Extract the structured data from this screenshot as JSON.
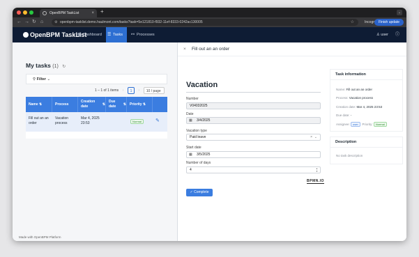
{
  "browser": {
    "tab_title": "OpenBPM TaskList",
    "url": "openbpm-tasklist.demo.haulmont.com/tasks?task=5e121810-f932-11ef-8333-0242ac130005",
    "incognito_label": "Incognito",
    "finish_update_label": "Finish update"
  },
  "app": {
    "logo": "OpenBPM TaskList",
    "nav": [
      "Dashboard",
      "Tasks",
      "Processes"
    ],
    "user": "user"
  },
  "tasks": {
    "title": "My tasks",
    "count": "(1)",
    "filter_label": "Filter",
    "pager_text": "1 – 1 of 1 items",
    "page": "1",
    "page_size": "10 / page",
    "columns": [
      "Name",
      "Process",
      "Creation date",
      "Due date",
      "Priority"
    ],
    "rows": [
      {
        "name": "Fill out an an order",
        "process": "Vacation process",
        "created": "Mar 4, 2025 23:53",
        "due": "",
        "priority": "Normal"
      }
    ],
    "made_with": "Made with OpenBPM Platform"
  },
  "panel": {
    "title": "Fill out an an order",
    "form_title": "Vacation",
    "fields": {
      "number_label": "Number",
      "number_value": "V04032025",
      "date_label": "Date",
      "date_value": "3/4/2025",
      "vacation_type_label": "Vacation type",
      "vacation_type_value": "Paid leave",
      "start_date_label": "Start date",
      "start_date_value": "3/5/2025",
      "days_label": "Number of days",
      "days_value": "4"
    },
    "stamp": "BPMN.IO",
    "complete_label": "Complete",
    "task_info": {
      "header": "Task information",
      "name_k": "Name:",
      "name_v": "Fill out an an order",
      "process_k": "Process:",
      "process_v": "Vacation process",
      "created_k": "Creation date:",
      "created_v": "Mar 4, 2025 23:53",
      "due_k": "Due date:",
      "due_v": "-",
      "assignee_k": "Assignee:",
      "assignee_v": "user",
      "priority_k": "Priority:",
      "priority_v": "Normal"
    },
    "description": {
      "header": "Description",
      "text": "No task description"
    }
  },
  "colors": {
    "brand_blue": "#3b7de0",
    "header_navy": "#0e1c34",
    "normal_badge": "#2e8b2e"
  }
}
